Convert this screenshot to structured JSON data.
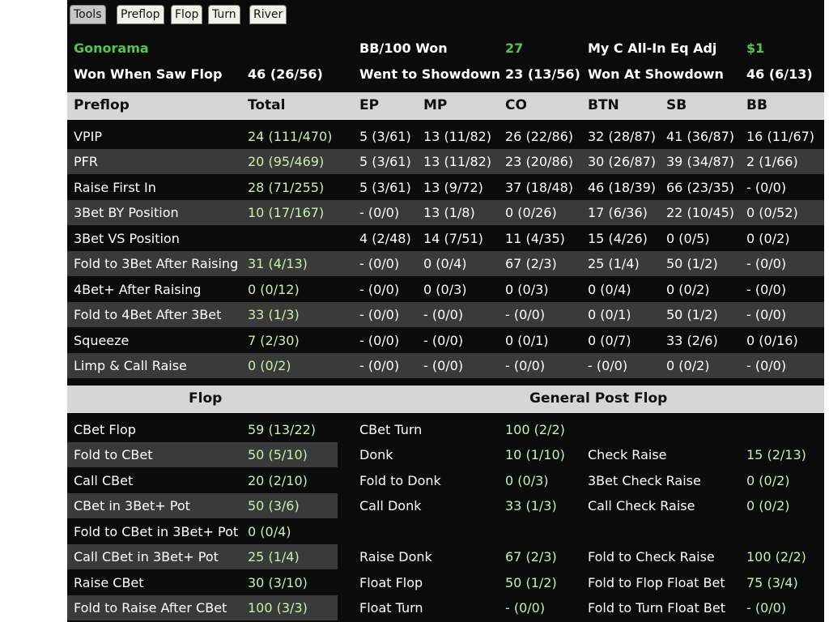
{
  "tabs": [
    "Tools",
    "Preflop",
    "Flop",
    "Turn",
    "River"
  ],
  "summary": {
    "row1": [
      "Gonorama",
      "BB/100 Won",
      "27",
      "My C All-In Eq Adj",
      "$1"
    ],
    "row2": [
      "Won When Saw Flop",
      "46 (26/56)",
      "Went to Showdown",
      "23 (13/56)",
      "Won At Showdown",
      "46 (6/13)"
    ]
  },
  "preflop": {
    "headers": [
      "Preflop",
      "Total",
      "EP",
      "MP",
      "CO",
      "BTN",
      "SB",
      "BB"
    ],
    "rows": [
      [
        "VPIP",
        "24 (111/470)",
        "5 (3/61)",
        "13 (11/82)",
        "26 (22/86)",
        "32 (28/87)",
        "41 (36/87)",
        "16 (11/67)"
      ],
      [
        "PFR",
        "20 (95/469)",
        "5 (3/61)",
        "13 (11/82)",
        "23 (20/86)",
        "30 (26/87)",
        "39 (34/87)",
        "2 (1/66)"
      ],
      [
        "Raise First In",
        "28 (71/255)",
        "5 (3/61)",
        "13 (9/72)",
        "37 (18/48)",
        "46 (18/39)",
        "66 (23/35)",
        "- (0/0)"
      ],
      [
        "3Bet BY Position",
        "10 (17/167)",
        "- (0/0)",
        "13 (1/8)",
        "0 (0/26)",
        "17 (6/36)",
        "22 (10/45)",
        "0 (0/52)"
      ],
      [
        "3Bet VS Position",
        "",
        "4 (2/48)",
        "14 (7/51)",
        "11 (4/35)",
        "15 (4/26)",
        "0 (0/5)",
        "0 (0/2)"
      ],
      [
        "Fold to 3Bet After Raising",
        "31 (4/13)",
        "- (0/0)",
        "0 (0/4)",
        "67 (2/3)",
        "25 (1/4)",
        "50 (1/2)",
        "- (0/0)"
      ],
      [
        "4Bet+ After Raising",
        "0 (0/12)",
        "- (0/0)",
        "0 (0/3)",
        "0 (0/3)",
        "0 (0/4)",
        "0 (0/2)",
        "- (0/0)"
      ],
      [
        "Fold to 4Bet After 3Bet",
        "33 (1/3)",
        "- (0/0)",
        "- (0/0)",
        "- (0/0)",
        "0 (0/1)",
        "50 (1/2)",
        "- (0/0)"
      ],
      [
        "Squeeze",
        "7 (2/30)",
        "- (0/0)",
        "- (0/0)",
        "0 (0/1)",
        "0 (0/7)",
        "33 (2/6)",
        "0 (0/16)"
      ],
      [
        "Limp & Call Raise",
        "0 (0/2)",
        "- (0/0)",
        "- (0/0)",
        "- (0/0)",
        "- (0/0)",
        "0 (0/2)",
        "- (0/0)"
      ]
    ]
  },
  "postflop": {
    "headers": [
      "Flop",
      "General Post Flop"
    ],
    "rows": [
      [
        "CBet Flop",
        "59 (13/22)",
        "CBet Turn",
        "100 (2/2)",
        "",
        ""
      ],
      [
        "Fold to CBet",
        "50 (5/10)",
        "Donk",
        "10 (1/10)",
        "Check Raise",
        "15 (2/13)"
      ],
      [
        "Call CBet",
        "20 (2/10)",
        "Fold to Donk",
        "0 (0/3)",
        "3Bet Check Raise",
        "0 (0/2)"
      ],
      [
        "CBet in 3Bet+ Pot",
        "50 (3/6)",
        "Call Donk",
        "33 (1/3)",
        "Call Check Raise",
        "0 (0/2)"
      ],
      [
        "Fold to CBet in 3Bet+ Pot",
        "0 (0/4)",
        "",
        "",
        "",
        ""
      ],
      [
        "Call CBet in 3Bet+ Pot",
        "25 (1/4)",
        "Raise Donk",
        "67 (2/3)",
        "Fold to Check Raise",
        "100 (2/2)"
      ],
      [
        "Raise CBet",
        "30 (3/10)",
        "Float Flop",
        "50 (1/2)",
        "Fold to Flop Float Bet",
        "75 (3/4)"
      ],
      [
        "Fold to Raise After CBet",
        "100 (3/3)",
        "Float Turn",
        "- (0/0)",
        "Fold to Turn Float Bet",
        "- (0/0)"
      ]
    ]
  }
}
